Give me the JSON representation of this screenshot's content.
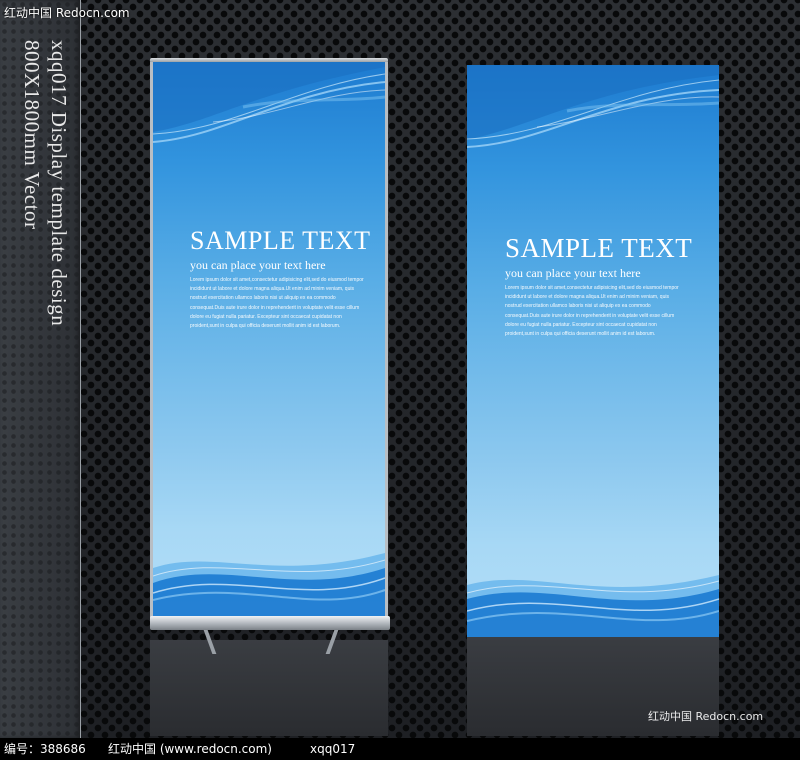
{
  "watermark_top": "红动中国 Redocn.com",
  "side_title": {
    "line1": "xqq017 Display template design",
    "line2": "800X1800mm Vector"
  },
  "banners": [
    {
      "title": "SAMPLE TEXT",
      "subtitle": "you can place your text here",
      "body_lines": [
        "Lorem ipsum dolor sit amet,consectetur adipisicing elit,sed do eiusmod tempor",
        "incididunt ut labore et dolore magna aliqua.Ut enim ad minim veniam, quis",
        "nostrud exercitation ullamco laboris nisi ut aliquip ex ea commodo",
        "consequat.Duis aute irure dolor in reprehenderit in voluptate velit esse cillum",
        "dolore eu fugiat nulla pariatur. Excepteur sint occaecat cupidatat non",
        "proident,sunt in culpa qui officia deserunt mollit anim id est laborum."
      ]
    },
    {
      "title": "SAMPLE TEXT",
      "subtitle": "you can place your text here",
      "body_lines": [
        "Lorem ipsum dolor sit amet,consectetur adipisicing elit,sed do eiusmod tempor",
        "incididunt ut labore et dolore magna aliqua.Ut enim ad minim veniam, quis",
        "nostrud exercitation ullamco laboris nisi ut aliquip ex ea commodo",
        "consequat.Duis aute irure dolor in reprehenderit in voluptate velit esse cillum",
        "dolore eu fugiat nulla pariatur. Excepteur sint occaecat cupidatat non",
        "proident,sunt in culpa qui officia deserunt mollit anim id est laborum."
      ]
    }
  ],
  "watermark_bottom_right": "红动中国 Redocn.com",
  "footer": {
    "id_label": "编号：388686",
    "site": "红动中国 (www.redocn.com)",
    "code": "xqq017"
  },
  "colors": {
    "banner_top": "#1d7bd0",
    "banner_bottom": "#b4def7",
    "background": "#232528"
  }
}
